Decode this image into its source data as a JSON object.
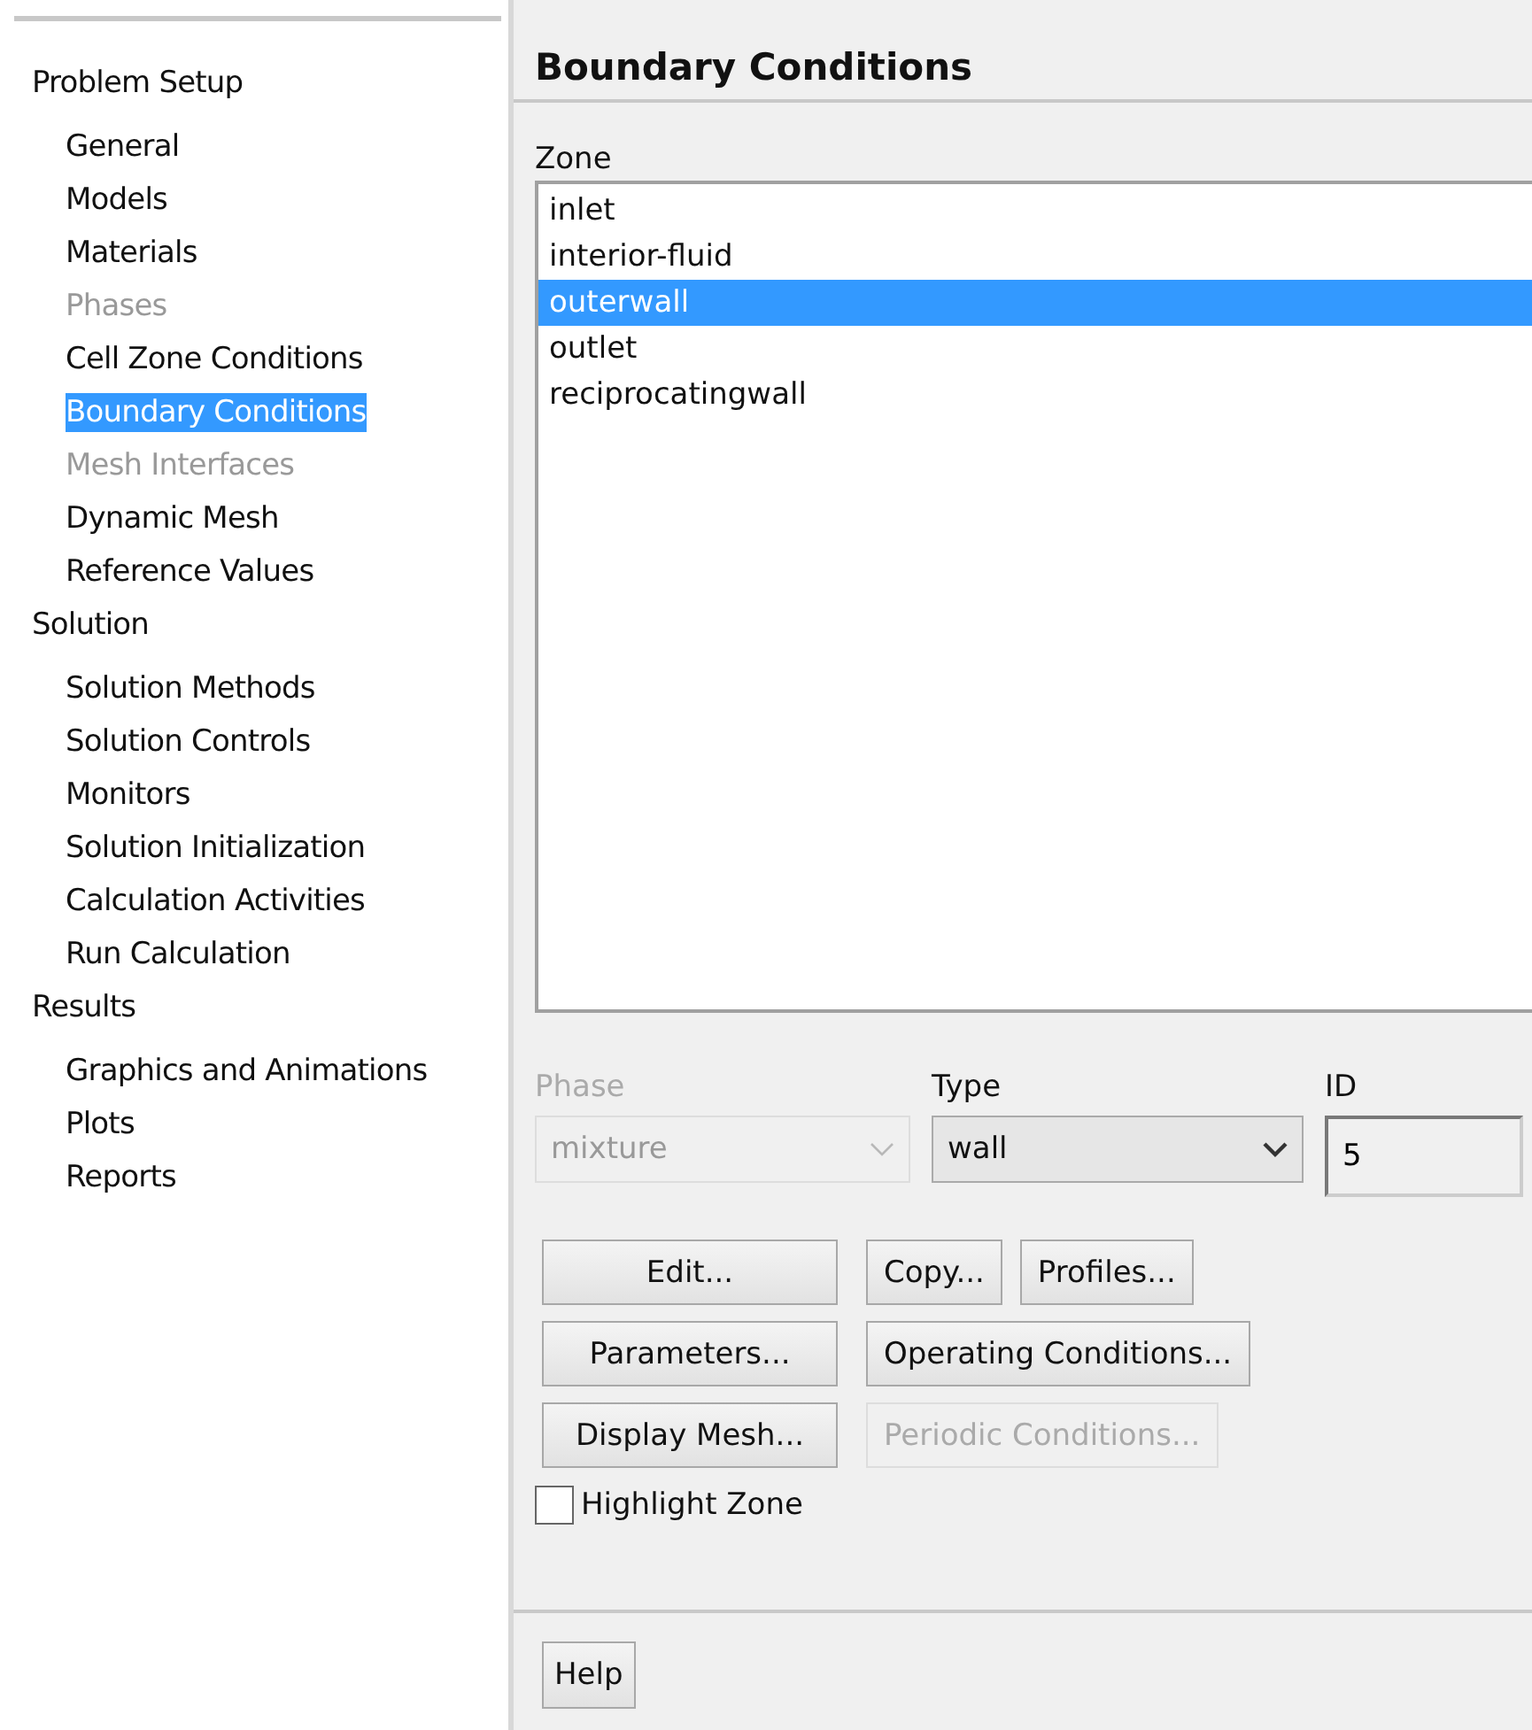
{
  "sidebar": {
    "sections": [
      {
        "label": "Problem Setup",
        "items": [
          {
            "label": "General",
            "selected": false,
            "disabled": false
          },
          {
            "label": "Models",
            "selected": false,
            "disabled": false
          },
          {
            "label": "Materials",
            "selected": false,
            "disabled": false
          },
          {
            "label": "Phases",
            "selected": false,
            "disabled": true
          },
          {
            "label": "Cell Zone Conditions",
            "selected": false,
            "disabled": false
          },
          {
            "label": "Boundary Conditions",
            "selected": true,
            "disabled": false
          },
          {
            "label": "Mesh Interfaces",
            "selected": false,
            "disabled": true
          },
          {
            "label": "Dynamic Mesh",
            "selected": false,
            "disabled": false
          },
          {
            "label": "Reference Values",
            "selected": false,
            "disabled": false
          }
        ]
      },
      {
        "label": "Solution",
        "items": [
          {
            "label": "Solution Methods",
            "selected": false,
            "disabled": false
          },
          {
            "label": "Solution Controls",
            "selected": false,
            "disabled": false
          },
          {
            "label": "Monitors",
            "selected": false,
            "disabled": false
          },
          {
            "label": "Solution Initialization",
            "selected": false,
            "disabled": false
          },
          {
            "label": "Calculation Activities",
            "selected": false,
            "disabled": false
          },
          {
            "label": "Run Calculation",
            "selected": false,
            "disabled": false
          }
        ]
      },
      {
        "label": "Results",
        "items": [
          {
            "label": "Graphics and Animations",
            "selected": false,
            "disabled": false
          },
          {
            "label": "Plots",
            "selected": false,
            "disabled": false
          },
          {
            "label": "Reports",
            "selected": false,
            "disabled": false
          }
        ]
      }
    ]
  },
  "panel": {
    "title": "Boundary Conditions",
    "zone": {
      "label": "Zone",
      "items": [
        {
          "label": "inlet",
          "selected": false
        },
        {
          "label": "interior-fluid",
          "selected": false
        },
        {
          "label": "outerwall",
          "selected": true
        },
        {
          "label": "outlet",
          "selected": false
        },
        {
          "label": "reciprocatingwall",
          "selected": false
        }
      ]
    },
    "phase": {
      "label": "Phase",
      "value": "mixture",
      "disabled": true
    },
    "type": {
      "label": "Type",
      "value": "wall",
      "disabled": false
    },
    "id": {
      "label": "ID",
      "value": "5"
    },
    "button_rows": [
      [
        {
          "label": "Edit...",
          "disabled": false
        },
        {
          "label": "Copy...",
          "disabled": false
        },
        {
          "label": "Profiles...",
          "disabled": false
        }
      ],
      [
        {
          "label": "Parameters...",
          "disabled": false
        },
        {
          "label": "Operating Conditions...",
          "disabled": false
        }
      ],
      [
        {
          "label": "Display Mesh...",
          "disabled": false
        },
        {
          "label": "Periodic Conditions...",
          "disabled": true
        }
      ]
    ],
    "highlight_zone": {
      "label": "Highlight Zone",
      "checked": false
    },
    "help_button": "Help"
  }
}
